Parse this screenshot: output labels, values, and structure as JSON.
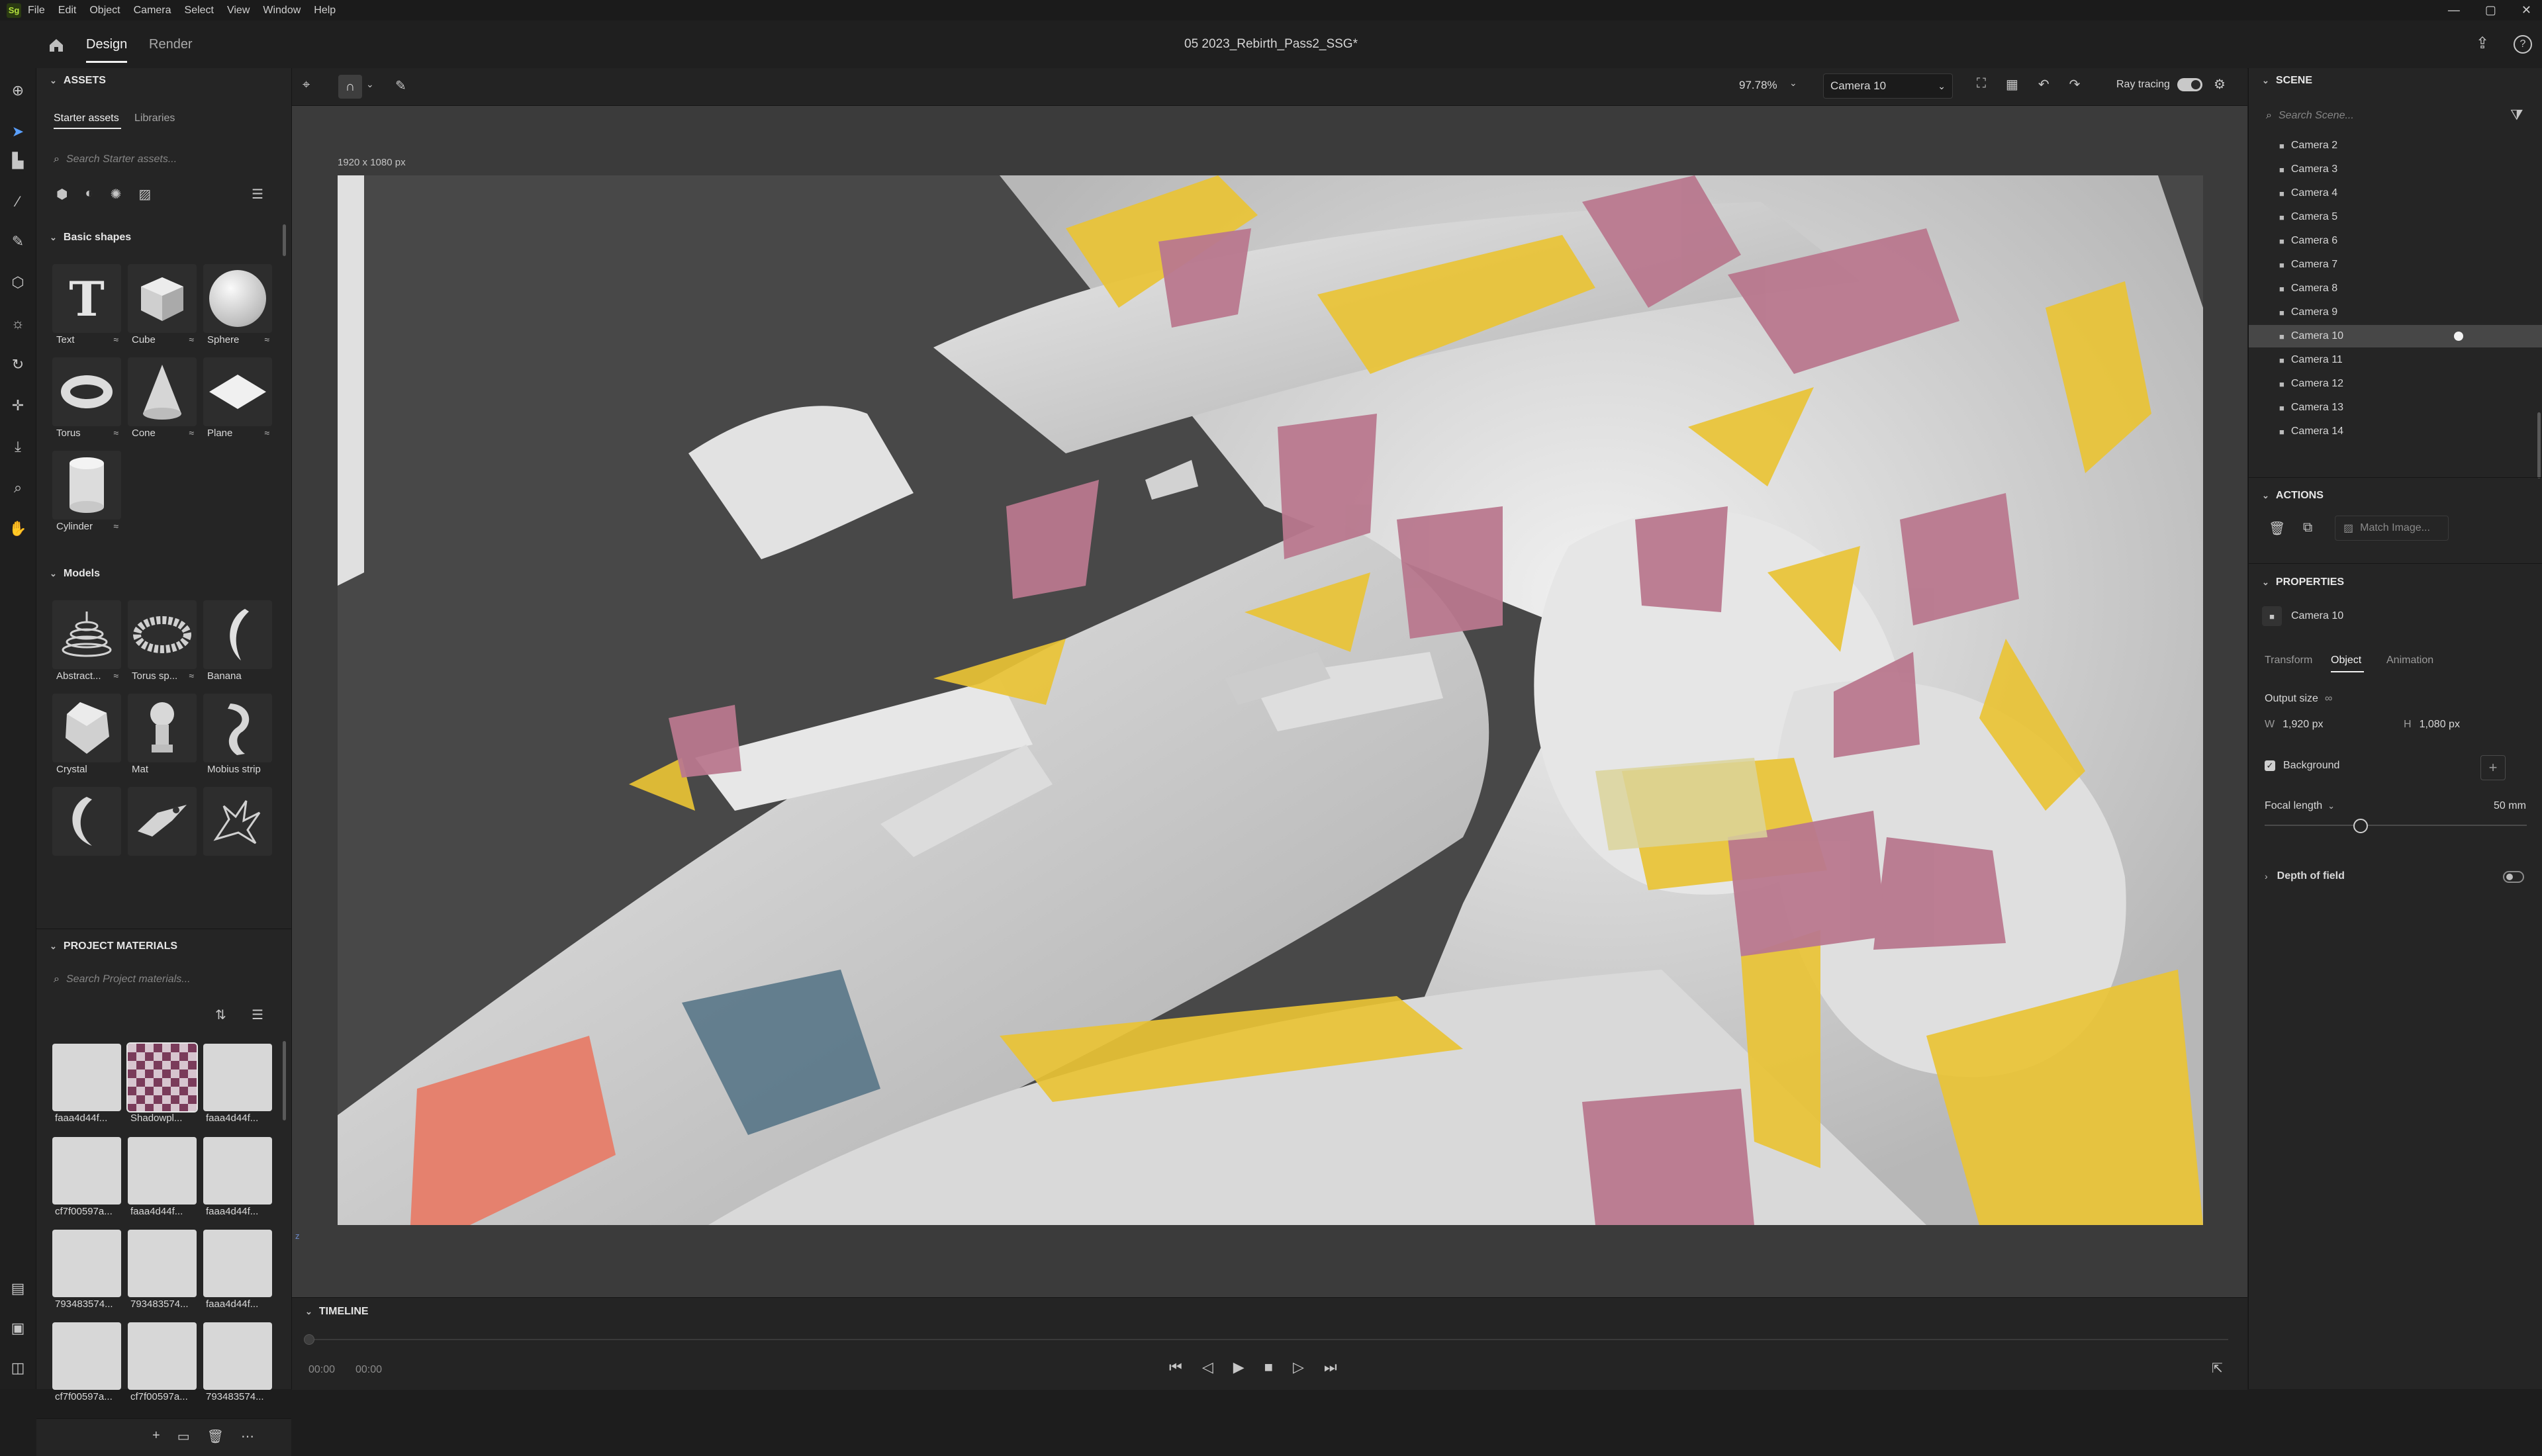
{
  "menubar": {
    "logo": "Sg",
    "items": [
      "File",
      "Edit",
      "Object",
      "Camera",
      "Select",
      "View",
      "Window",
      "Help"
    ]
  },
  "header": {
    "tabs": [
      {
        "label": "Design",
        "active": true
      },
      {
        "label": "Render",
        "active": false
      }
    ],
    "doc_title": "05 2023_Rebirth_Pass2_SSG*"
  },
  "assets": {
    "title": "ASSETS",
    "tabs": [
      "Starter assets",
      "Libraries"
    ],
    "search_placeholder": "Search Starter assets...",
    "basic_shapes_title": "Basic shapes",
    "basic_shapes": [
      "Text",
      "Cube",
      "Sphere",
      "Torus",
      "Cone",
      "Plane",
      "Cylinder"
    ],
    "models_title": "Models",
    "models": [
      "Abstract...",
      "Torus sp...",
      "Banana",
      "Crystal",
      "Mat",
      "Mobius strip",
      "",
      "",
      ""
    ],
    "project_materials_title": "PROJECT MATERIALS",
    "materials_search_placeholder": "Search Project materials...",
    "materials": [
      "faaa4d44f...",
      "Shadowpl...",
      "faaa4d44f...",
      "cf7f00597a...",
      "faaa4d44f...",
      "faaa4d44f...",
      "793483574...",
      "793483574...",
      "faaa4d44f...",
      "cf7f00597a...",
      "cf7f00597a...",
      "793483574..."
    ]
  },
  "viewport": {
    "zoom": "97.78%",
    "camera": "Camera 10",
    "ray_tracing_label": "Ray tracing",
    "ray_tracing_on": true,
    "canvas_size": "1920 x 1080 px",
    "axis_label": "z"
  },
  "timeline": {
    "title": "TIMELINE",
    "time_current": "00:00",
    "time_total": "00:00"
  },
  "scene": {
    "title": "SCENE",
    "search_placeholder": "Search Scene...",
    "cameras": [
      "Camera 2",
      "Camera 3",
      "Camera 4",
      "Camera 5",
      "Camera 6",
      "Camera 7",
      "Camera 8",
      "Camera 9",
      "Camera 10",
      "Camera 11",
      "Camera 12",
      "Camera 13",
      "Camera 14"
    ],
    "selected": "Camera 10"
  },
  "actions": {
    "title": "ACTIONS",
    "match_image": "Match Image..."
  },
  "properties": {
    "title": "PROPERTIES",
    "object_name": "Camera 10",
    "tabs": [
      "Transform",
      "Object",
      "Animation"
    ],
    "active_tab": "Object",
    "output_size_label": "Output size",
    "w_label": "W",
    "w_value": "1,920 px",
    "h_label": "H",
    "h_value": "1,080 px",
    "background_label": "Background",
    "background_checked": true,
    "focal_length_label": "Focal length",
    "focal_length_value": "50 mm",
    "depth_of_field_label": "Depth of field",
    "depth_of_field_on": false
  },
  "colors": {
    "accent": "#b5e23d",
    "panel": "#252525",
    "canvas": "#484848"
  }
}
